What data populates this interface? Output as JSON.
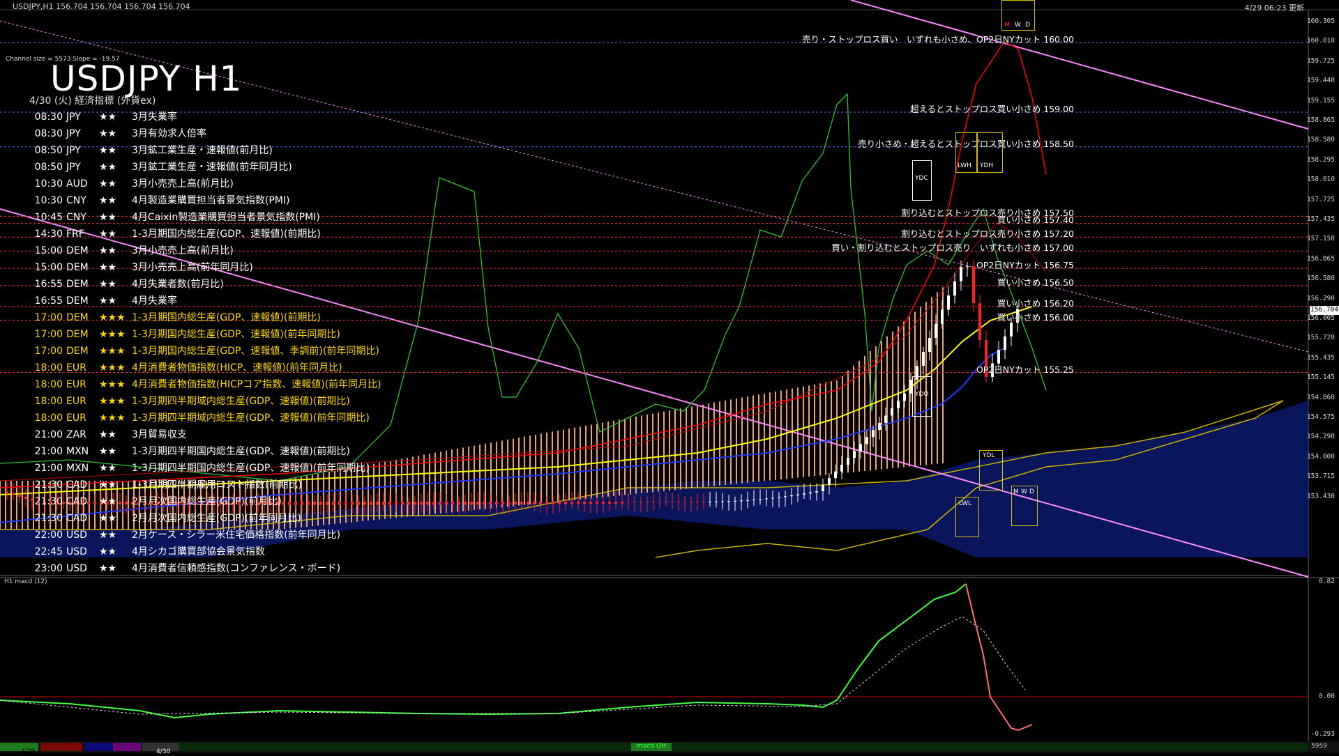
{
  "window": {
    "symbol_info": "USDJPY,H1   156.704 156.704 156.704 156.704",
    "server_time": "4/29 06:23 更新",
    "channel_info": "Channel size = 5573 Slope = -19.57",
    "big_title": "USDJPY H1",
    "subtitle": "4/30 (火) 経済指標 (外貨ex)"
  },
  "events": [
    {
      "time": "08:30",
      "cur": "JPY",
      "stars": "★★",
      "name": "3月失業率",
      "color": "#ffffff"
    },
    {
      "time": "08:30",
      "cur": "JPY",
      "stars": "★★",
      "name": "3月有効求人倍率",
      "color": "#ffffff"
    },
    {
      "time": "08:50",
      "cur": "JPY",
      "stars": "★★",
      "name": "3月鉱工業生産・速報値(前月比)",
      "color": "#ffffff"
    },
    {
      "time": "08:50",
      "cur": "JPY",
      "stars": "★★",
      "name": "3月鉱工業生産・速報値(前年同月比)",
      "color": "#ffffff"
    },
    {
      "time": "10:30",
      "cur": "AUD",
      "stars": "★★",
      "name": "3月小売売上高(前月比)",
      "color": "#ffffff"
    },
    {
      "time": "10:30",
      "cur": "CNY",
      "stars": "★★",
      "name": "4月製造業購買担当者景気指数(PMI)",
      "color": "#ffffff"
    },
    {
      "time": "10:45",
      "cur": "CNY",
      "stars": "★★",
      "name": "4月Caixin製造業購買担当者景気指数(PMI)",
      "color": "#ffffff"
    },
    {
      "time": "14:30",
      "cur": "FRF",
      "stars": "★★",
      "name": "1-3月期国内総生産(GDP、速報値)(前期比)",
      "color": "#ffffff"
    },
    {
      "time": "15:00",
      "cur": "DEM",
      "stars": "★★",
      "name": "3月小売売上高(前月比)",
      "color": "#ffffff"
    },
    {
      "time": "15:00",
      "cur": "DEM",
      "stars": "★★",
      "name": "3月小売売上高(前年同月比)",
      "color": "#ffffff"
    },
    {
      "time": "16:55",
      "cur": "DEM",
      "stars": "★★",
      "name": "4月失業者数(前月比)",
      "color": "#ffffff"
    },
    {
      "time": "16:55",
      "cur": "DEM",
      "stars": "★★",
      "name": "4月失業率",
      "color": "#ffffff"
    },
    {
      "time": "17:00",
      "cur": "DEM",
      "stars": "★★★",
      "name": "1-3月期国内総生産(GDP、速報値)(前期比)",
      "color": "#ffd700"
    },
    {
      "time": "17:00",
      "cur": "DEM",
      "stars": "★★★",
      "name": "1-3月期国内総生産(GDP、速報値)(前年同期比)",
      "color": "#ffd700"
    },
    {
      "time": "17:00",
      "cur": "DEM",
      "stars": "★★★",
      "name": "1-3月期国内総生産(GDP、速報値、季調前)(前年同期比)",
      "color": "#ffd700"
    },
    {
      "time": "18:00",
      "cur": "EUR",
      "stars": "★★★",
      "name": "4月消費者物価指数(HICP、速報値)(前年同月比)",
      "color": "#ffd700"
    },
    {
      "time": "18:00",
      "cur": "EUR",
      "stars": "★★★",
      "name": "4月消費者物価指数(HICPコア指数、速報値)(前年同月比)",
      "color": "#ffd700"
    },
    {
      "time": "18:00",
      "cur": "EUR",
      "stars": "★★★",
      "name": "1-3月期四半期域内総生産(GDP、速報値)(前期比)",
      "color": "#ffd700"
    },
    {
      "time": "18:00",
      "cur": "EUR",
      "stars": "★★★",
      "name": "1-3月期四半期域内総生産(GDP、速報値)(前年同期比)",
      "color": "#ffd700"
    },
    {
      "time": "21:00",
      "cur": "ZAR",
      "stars": "★★",
      "name": "3月貿易収支",
      "color": "#ffffff"
    },
    {
      "time": "21:00",
      "cur": "MXN",
      "stars": "★★",
      "name": "1-3月期四半期国内総生産(GDP、速報値)(前期比)",
      "color": "#ffffff"
    },
    {
      "time": "21:00",
      "cur": "MXN",
      "stars": "★★",
      "name": "1-3月期四半期国内総生産(GDP、速報値)(前年同期比)",
      "color": "#ffffff"
    },
    {
      "time": "21:30",
      "cur": "CAD",
      "stars": "★★",
      "name": "1-3月期四半期雇用コスト指数(前期比)",
      "color": "#ffffff"
    },
    {
      "time": "21:30",
      "cur": "CAD",
      "stars": "★★",
      "name": "2月月次国内総生産(GDP)(前月比)",
      "color": "#ffffff"
    },
    {
      "time": "21:30",
      "cur": "CAD",
      "stars": "★★",
      "name": "2月月次国内総生産(GDP)(前年同月比)",
      "color": "#ffffff"
    },
    {
      "time": "22:00",
      "cur": "USD",
      "stars": "★★",
      "name": "2月ケース・シラー米住宅価格指数(前年同月比)",
      "color": "#ffffff"
    },
    {
      "time": "22:45",
      "cur": "USD",
      "stars": "★★",
      "name": "4月シカゴ購買部協会景気指数",
      "color": "#ffffff"
    },
    {
      "time": "23:00",
      "cur": "USD",
      "stars": "★★",
      "name": "4月消費者信頼感指数(コンファレンス・ボード)",
      "color": "#ffffff"
    }
  ],
  "price_axis": [
    "160.305",
    "160.010",
    "159.725",
    "159.440",
    "159.155",
    "158.865",
    "158.580",
    "158.295",
    "158.010",
    "157.725",
    "157.435",
    "157.150",
    "156.865",
    "156.580",
    "156.290",
    "156.005",
    "155.720",
    "155.435",
    "155.145",
    "154.860",
    "154.575",
    "154.290",
    "154.000",
    "153.715",
    "153.430"
  ],
  "current_price": "156.704",
  "levels": [
    {
      "price": 160.0,
      "text": "売り・ストップロス買い　いずれも小さめ、OP2日NYカット 160.00",
      "color": "#4a7dff"
    },
    {
      "price": 159.0,
      "text": "超えるとストップロス買い小さめ 159.00",
      "color": "#4a7dff"
    },
    {
      "price": 158.5,
      "text": "売り小さめ・超えるとストップロス買い小さめ 158.50",
      "color": "#4a7dff"
    },
    {
      "price": 157.5,
      "text": "割り込むとストップロス売り小さめ 157.50",
      "color": "#ff3030"
    },
    {
      "price": 157.4,
      "text": "買い小さめ 157.40",
      "color": "#ff3030"
    },
    {
      "price": 157.2,
      "text": "割り込むとストップロス売り小さめ 157.20",
      "color": "#ff3030"
    },
    {
      "price": 157.0,
      "text": "買い・割り込むとストップロス売り　いずれも小さめ 157.00",
      "color": "#ff3030"
    },
    {
      "price": 156.75,
      "text": "OP2日NYカット 156.75",
      "color": "#ff3030"
    },
    {
      "price": 156.5,
      "text": "買い小さめ 156.50",
      "color": "#ff3030"
    },
    {
      "price": 156.2,
      "text": "買い小さめ 156.20",
      "color": "#ff3030"
    },
    {
      "price": 156.0,
      "text": "買い小さめ 156.00",
      "color": "#ff3030"
    },
    {
      "price": 155.25,
      "text": "OP2日NYカット 155.25",
      "color": "#ff3030"
    }
  ],
  "boxes": {
    "ydc_top": "YDC",
    "ydc_bottom": "YDO",
    "lwh": "LWH",
    "ydh": "YDH",
    "ydl": "YDL",
    "lwl": "LWL",
    "mwd": [
      "M",
      "W",
      "D"
    ],
    "mwd_bottom": [
      "M",
      "W",
      "D"
    ]
  },
  "macd": {
    "title": "H1  macd (12)",
    "axis": [
      "0.82",
      "0.00",
      "-0.293"
    ]
  },
  "bottom_bar": {
    "date1": "4/29",
    "date2": "4/30",
    "label": "macd OH",
    "num": "5959"
  },
  "colors": {
    "bg": "#000000",
    "ma_yellow": "#ffff00",
    "ma_blue": "#1e3cff",
    "ma_red": "#ff0000",
    "cloud": "#0a1a70",
    "macd_green": "#40ff40",
    "channel": "#ff88ff"
  }
}
